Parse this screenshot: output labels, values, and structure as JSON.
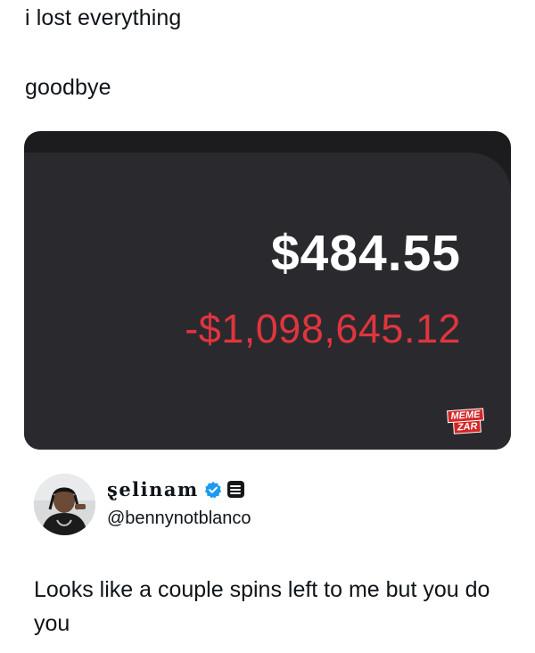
{
  "post": {
    "line1": "i lost everything",
    "line2": "goodbye"
  },
  "card": {
    "balance": "$484.55",
    "change": "-$1,098,645.12",
    "watermark_line1": "MEME",
    "watermark_line2": "ZAR"
  },
  "reply": {
    "display_name": "ȿelinam",
    "handle": "@bennynotblanco",
    "text": "Looks like a couple spins left to me but you do you"
  },
  "colors": {
    "loss_red": "#e0353e",
    "card_bg": "#2a2a2e",
    "verified_blue": "#1d9bf0"
  },
  "icons": {
    "verified": "verified-badge-icon",
    "affiliate": "affiliate-badge-icon"
  }
}
